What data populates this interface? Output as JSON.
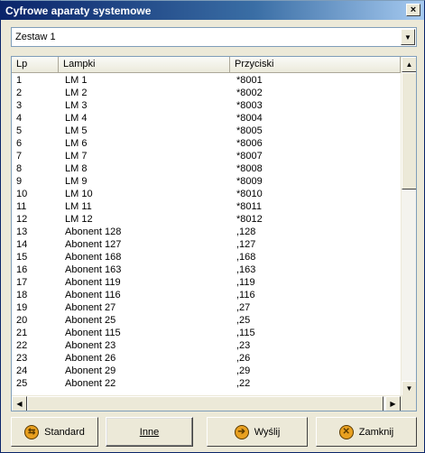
{
  "window": {
    "title": "Cyfrowe aparaty systemowe",
    "close_glyph": "×"
  },
  "combo": {
    "value": "Zestaw 1",
    "arrow": "▼"
  },
  "list": {
    "headers": [
      "Lp",
      "Lampki",
      "Przyciski"
    ],
    "rows": [
      [
        "1",
        "LM 1",
        "*8001"
      ],
      [
        "2",
        "LM 2",
        "*8002"
      ],
      [
        "3",
        "LM 3",
        "*8003"
      ],
      [
        "4",
        "LM 4",
        "*8004"
      ],
      [
        "5",
        "LM 5",
        "*8005"
      ],
      [
        "6",
        "LM 6",
        "*8006"
      ],
      [
        "7",
        "LM 7",
        "*8007"
      ],
      [
        "8",
        "LM 8",
        "*8008"
      ],
      [
        "9",
        "LM 9",
        "*8009"
      ],
      [
        "10",
        "LM 10",
        "*8010"
      ],
      [
        "11",
        "LM 11",
        "*8011"
      ],
      [
        "12",
        "LM 12",
        "*8012"
      ],
      [
        "13",
        "Abonent 128",
        ",128"
      ],
      [
        "14",
        "Abonent 127",
        ",127"
      ],
      [
        "15",
        "Abonent 168",
        ",168"
      ],
      [
        "16",
        "Abonent 163",
        ",163"
      ],
      [
        "17",
        "Abonent 119",
        ",119"
      ],
      [
        "18",
        "Abonent 116",
        ",116"
      ],
      [
        "19",
        "Abonent 27",
        ",27"
      ],
      [
        "20",
        "Abonent 25",
        ",25"
      ],
      [
        "21",
        "Abonent 115",
        ",115"
      ],
      [
        "22",
        "Abonent 23",
        ",23"
      ],
      [
        "23",
        "Abonent 26",
        ",26"
      ],
      [
        "24",
        "Abonent 29",
        ",29"
      ],
      [
        "25",
        "Abonent 22",
        ",22"
      ]
    ]
  },
  "buttons": {
    "standard": "Standard",
    "inne": "Inne",
    "wyslij": "Wyślij",
    "zamknij": "Zamknij"
  },
  "colors": {
    "title_gradient_start": "#0a246a",
    "title_gradient_end": "#a6caf0",
    "face": "#ece9d8"
  }
}
